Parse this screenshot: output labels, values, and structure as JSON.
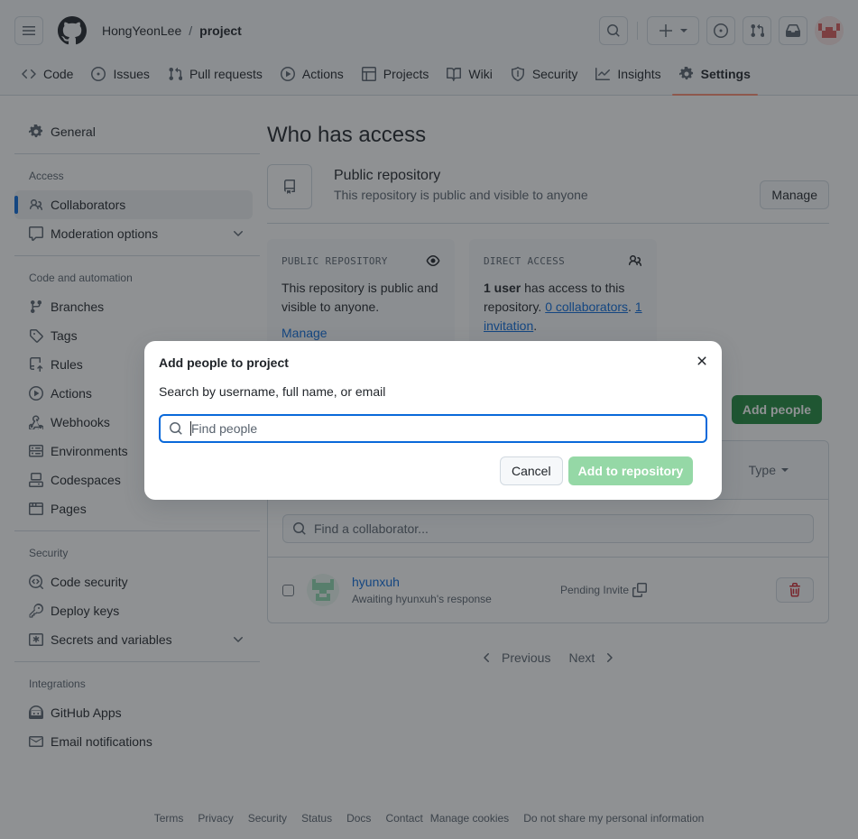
{
  "header": {
    "owner": "HongYeonLee",
    "separator": "/",
    "repo": "project"
  },
  "tabs": [
    {
      "label": "Code",
      "icon": "code-icon"
    },
    {
      "label": "Issues",
      "icon": "issue-icon"
    },
    {
      "label": "Pull requests",
      "icon": "pull-request-icon"
    },
    {
      "label": "Actions",
      "icon": "play-icon"
    },
    {
      "label": "Projects",
      "icon": "table-icon"
    },
    {
      "label": "Wiki",
      "icon": "book-icon"
    },
    {
      "label": "Security",
      "icon": "shield-icon"
    },
    {
      "label": "Insights",
      "icon": "graph-icon"
    },
    {
      "label": "Settings",
      "icon": "gear-icon",
      "active": true
    }
  ],
  "sidebar": {
    "general": "General",
    "access_heading": "Access",
    "collaborators": "Collaborators",
    "moderation": "Moderation options",
    "code_heading": "Code and automation",
    "branches": "Branches",
    "tags": "Tags",
    "rules": "Rules",
    "actions": "Actions",
    "webhooks": "Webhooks",
    "environments": "Environments",
    "codespaces": "Codespaces",
    "pages": "Pages",
    "security_heading": "Security",
    "code_security": "Code security",
    "deploy_keys": "Deploy keys",
    "secrets": "Secrets and variables",
    "integrations_heading": "Integrations",
    "github_apps": "GitHub Apps",
    "email_notifications": "Email notifications"
  },
  "main": {
    "title": "Who has access",
    "public_title": "Public repository",
    "public_sub": "This repository is public and visible to anyone",
    "manage_button": "Manage",
    "card_public": {
      "heading": "PUBLIC REPOSITORY",
      "body": "This repository is public and visible to anyone.",
      "link": "Manage"
    },
    "card_direct": {
      "heading": "DIRECT ACCESS",
      "bold": "1 user",
      "text": " has access to this repository. ",
      "link1": "0 collaborators",
      "punct1": ".",
      "link2": "1 invitation",
      "punct2": "."
    },
    "add_people_button": "Add people",
    "type_filter": "Type",
    "search_placeholder": "Find a collaborator...",
    "row": {
      "username": "hyunxuh",
      "subtitle": "Awaiting hyunxuh's response",
      "status": "Pending Invite"
    },
    "pager": {
      "previous": "Previous",
      "next": "Next"
    }
  },
  "footer": [
    "Terms",
    "Privacy",
    "Security",
    "Status",
    "Docs",
    "Contact",
    "Manage cookies",
    "Do not share my personal information"
  ],
  "dialog": {
    "title": "Add people to project",
    "label": "Search by username, full name, or email",
    "placeholder": "Find people",
    "value": "",
    "cancel": "Cancel",
    "submit": "Add to repository"
  },
  "colors": {
    "primary_green": "#1f883d",
    "disabled_green": "#95d8a6",
    "link_blue": "#0969da",
    "danger_red": "#d1242f",
    "tab_underline": "#fd8c73"
  }
}
